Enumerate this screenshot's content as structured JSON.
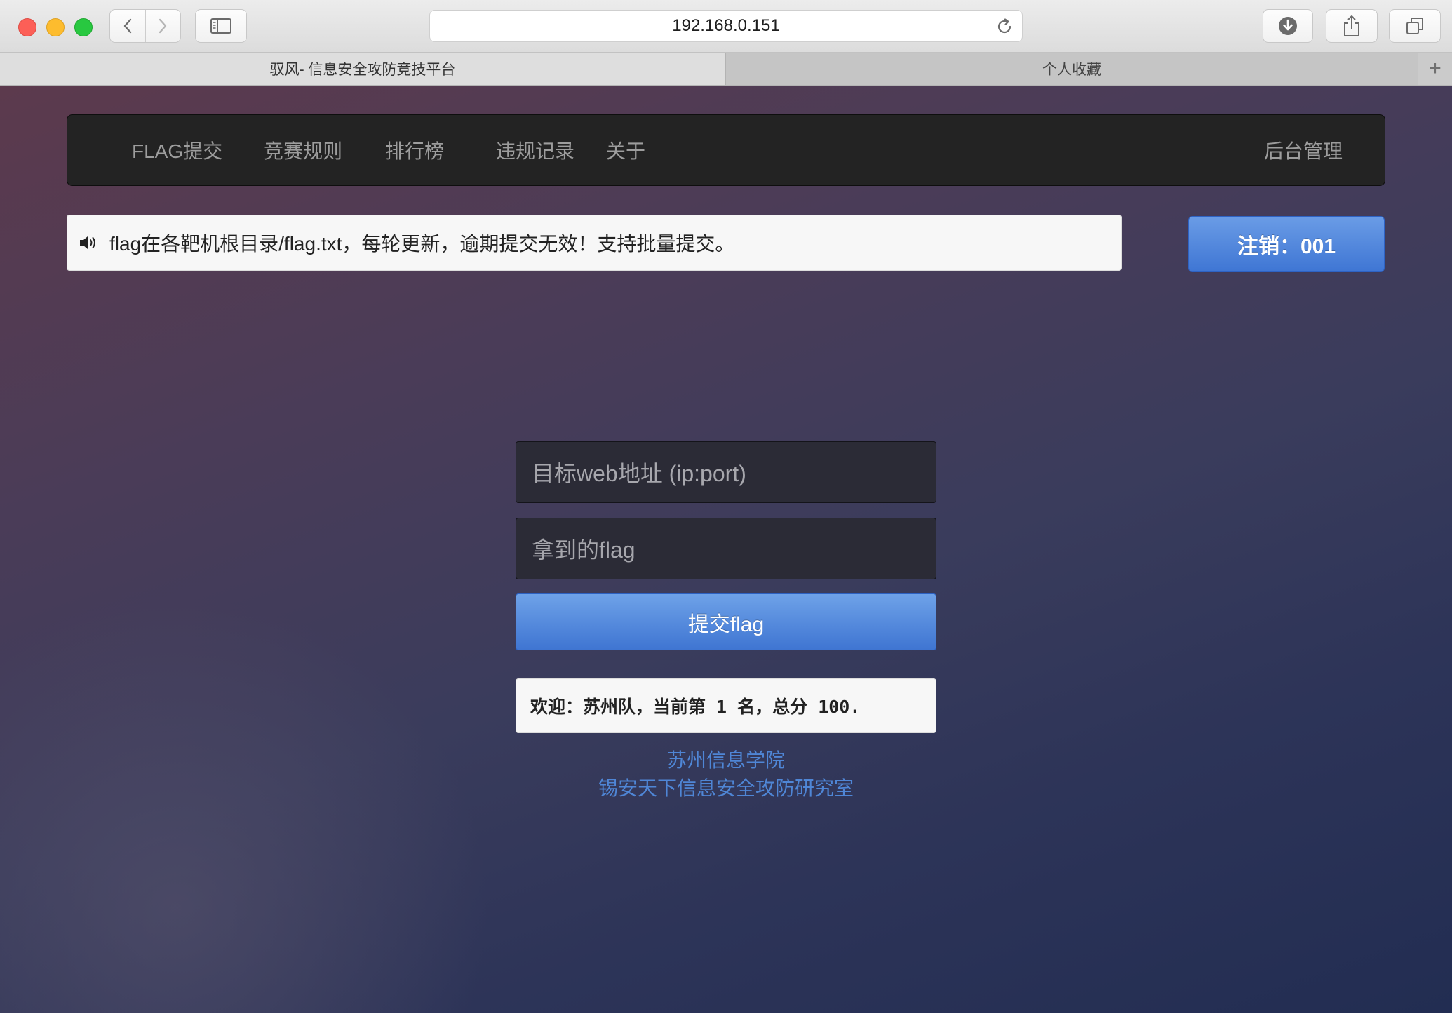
{
  "browser": {
    "url": "192.168.0.151",
    "tabs": [
      {
        "label": "驭风- 信息安全攻防竞技平台",
        "active": true
      },
      {
        "label": "个人收藏",
        "active": false
      }
    ],
    "new_tab_label": "+"
  },
  "navbar": {
    "items": [
      {
        "label": "FLAG提交"
      },
      {
        "label": "竞赛规则"
      },
      {
        "label": "排行榜"
      },
      {
        "label": "违规记录"
      },
      {
        "label": "关于"
      }
    ],
    "admin_label": "后台管理"
  },
  "notice": {
    "icon": "speaker-icon",
    "text": "flag在各靶机根目录/flag.txt，每轮更新，逾期提交无效！支持批量提交。"
  },
  "account": {
    "logout_label": "注销：001"
  },
  "form": {
    "target_placeholder": "目标web地址 (ip:port)",
    "flag_placeholder": "拿到的flag",
    "submit_label": "提交flag"
  },
  "status": {
    "welcome_text": "欢迎：苏州队，当前第 1 名，总分 100."
  },
  "footer": {
    "line1": "苏州信息学院",
    "line2": "锡安天下信息安全攻防研究室"
  },
  "colors": {
    "accent": "#4a82d8",
    "navbar_bg": "#232323",
    "link": "#4f86d6"
  }
}
